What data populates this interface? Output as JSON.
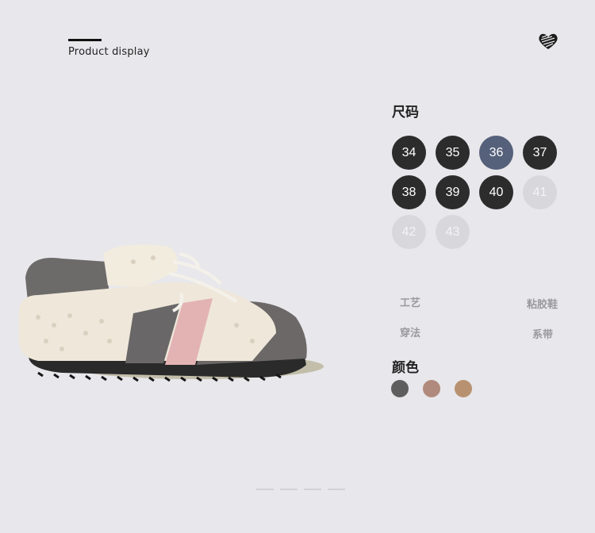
{
  "header": {
    "title": "Product display",
    "heart_icon": "scribble-heart-icon"
  },
  "product": {
    "image": "sherpa-sneaker-image"
  },
  "size": {
    "label": "尺码",
    "options": [
      {
        "value": "34",
        "state": "available"
      },
      {
        "value": "35",
        "state": "available"
      },
      {
        "value": "36",
        "state": "selected"
      },
      {
        "value": "37",
        "state": "available"
      },
      {
        "value": "38",
        "state": "available"
      },
      {
        "value": "39",
        "state": "available"
      },
      {
        "value": "40",
        "state": "available"
      },
      {
        "value": "41",
        "state": "unavailable"
      },
      {
        "value": "42",
        "state": "unavailable"
      },
      {
        "value": "43",
        "state": "unavailable"
      }
    ]
  },
  "specs": [
    {
      "name": "工艺",
      "value": "粘胶鞋"
    },
    {
      "name": "穿法",
      "value": "系带"
    }
  ],
  "color": {
    "label": "颜色",
    "swatches": [
      "#5f5e5e",
      "#b08a7c",
      "#b89270"
    ]
  },
  "pagination": {
    "count": 4
  }
}
